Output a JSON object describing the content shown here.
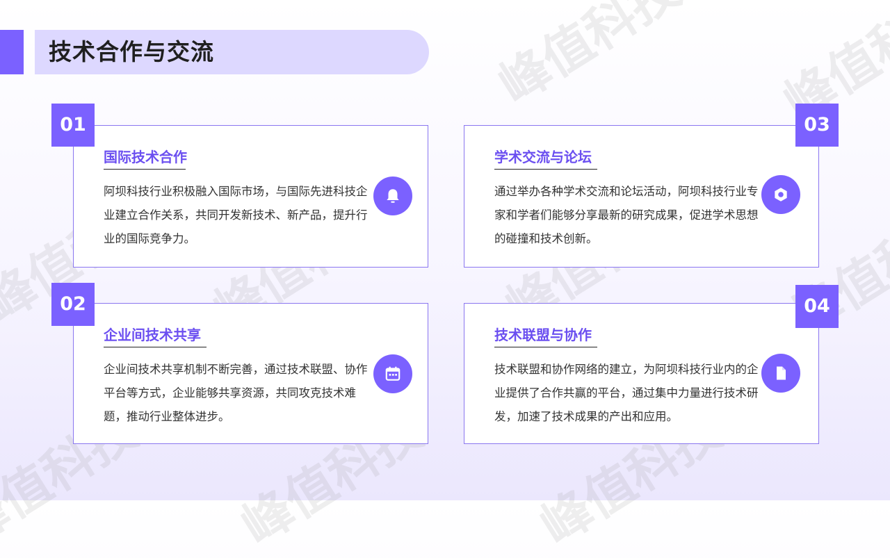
{
  "title": "技术合作与交流",
  "watermark": "峰值科技",
  "cards": [
    {
      "number": "01",
      "title": "国际技术合作",
      "desc": "阿坝科技行业积极融入国际市场，与国际先进科技企业建立合作关系，共同开发新技术、新产品，提升行业的国际竞争力。",
      "icon": "bell-icon"
    },
    {
      "number": "02",
      "title": "企业间技术共享",
      "desc": "企业间技术共享机制不断完善，通过技术联盟、协作平台等方式，企业能够共享资源，共同攻克技术难题，推动行业整体进步。",
      "icon": "calendar-icon"
    },
    {
      "number": "03",
      "title": "学术交流与论坛",
      "desc": "通过举办各种学术交流和论坛活动，阿坝科技行业专家和学者们能够分享最新的研究成果，促进学术思想的碰撞和技术创新。",
      "icon": "hexagon-nut-icon"
    },
    {
      "number": "04",
      "title": "技术联盟与协作",
      "desc": "技术联盟和协作网络的建立，为阿坝科技行业内的企业提供了合作共赢的平台，通过集中力量进行技术研发，加速了技术成果的产出和应用。",
      "icon": "document-icon"
    }
  ],
  "colors": {
    "accent": "#7b61ff",
    "title_pill": "#ddd8ff",
    "card_title": "#6b4ff0"
  }
}
